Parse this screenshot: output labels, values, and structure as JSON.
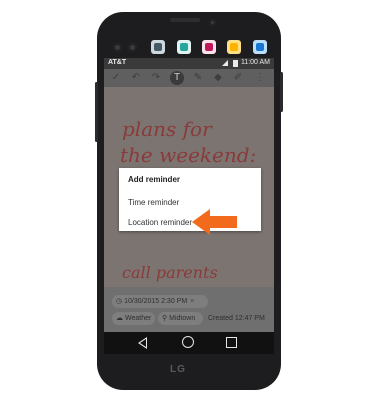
{
  "status_bar": {
    "carrier": "AT&T",
    "time": "11:00 AM"
  },
  "toolbar": {
    "icons": [
      "check-icon",
      "undo-icon",
      "redo-icon",
      "text-tool-icon",
      "pen-icon",
      "eraser-icon",
      "highlighter-icon",
      "more-icon"
    ],
    "selected": "text-tool-icon"
  },
  "note": {
    "handwriting_line1": "plans for",
    "handwriting_line2": "the weekend:",
    "handwriting_line3": "call parents"
  },
  "dialog": {
    "title": "Add reminder",
    "options": [
      "Time reminder",
      "Location reminder"
    ]
  },
  "reminder_chip": {
    "datetime": "10/30/2015 2:30 PM",
    "close": "×"
  },
  "info": {
    "weather": "Weather",
    "location": "Midtown",
    "created": "Created 12:47 PM"
  },
  "device": {
    "brand": "LG"
  },
  "colors": {
    "annotation_arrow": "#f26a1b",
    "handwriting": "#8a3a3a"
  }
}
